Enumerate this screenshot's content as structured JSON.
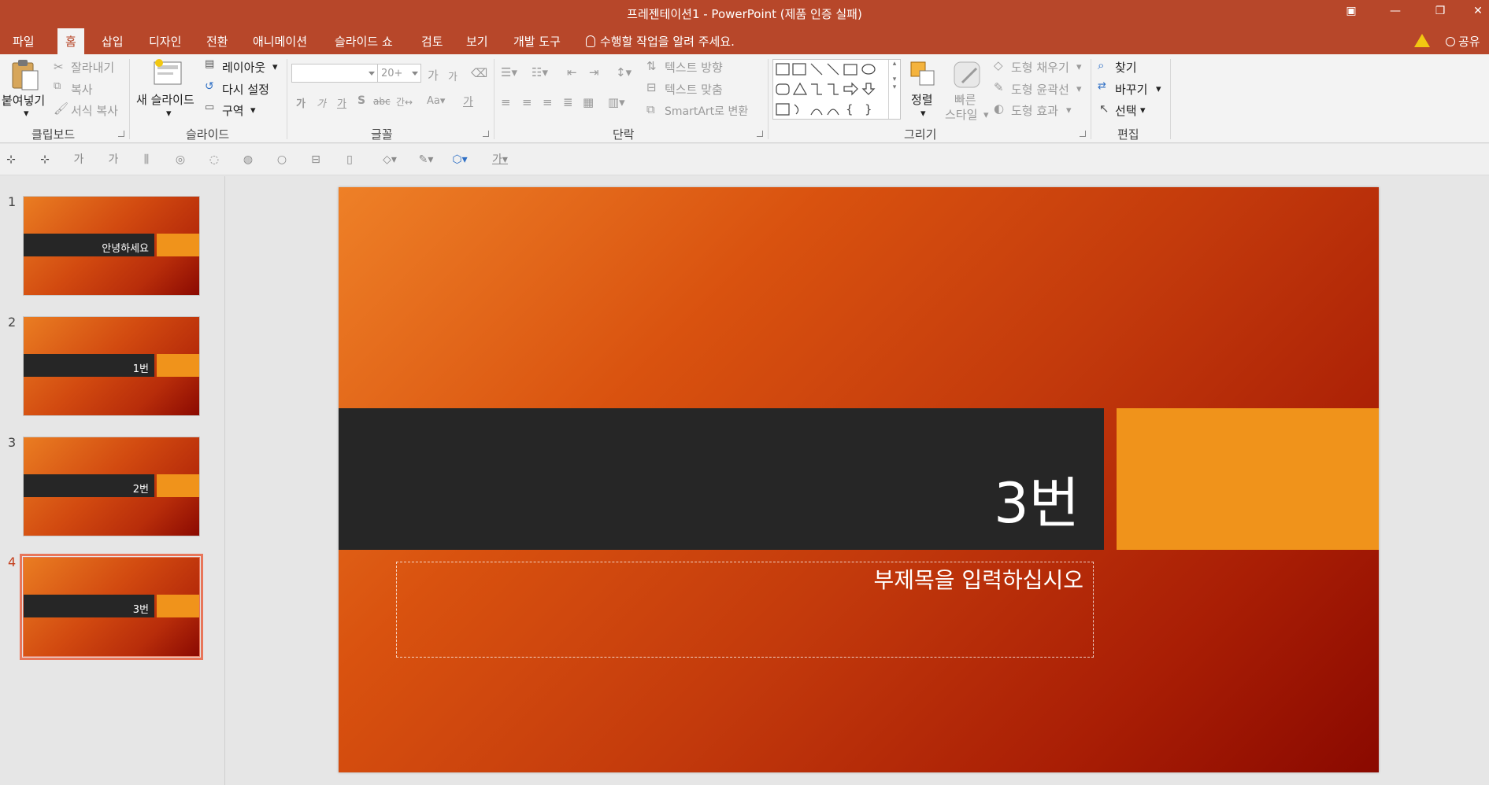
{
  "window": {
    "title": "프레젠테이션1 - PowerPoint (제품 인증 실패)",
    "controls": [
      "ribbon-display-icon",
      "minimize-icon",
      "restore-icon",
      "close-icon"
    ]
  },
  "tabs": [
    {
      "label": "파일",
      "active": false
    },
    {
      "label": "홈",
      "active": true
    },
    {
      "label": "삽입",
      "active": false
    },
    {
      "label": "디자인",
      "active": false
    },
    {
      "label": "전환",
      "active": false
    },
    {
      "label": "애니메이션",
      "active": false
    },
    {
      "label": "슬라이드 쇼",
      "active": false
    },
    {
      "label": "검토",
      "active": false
    },
    {
      "label": "보기",
      "active": false
    },
    {
      "label": "개발 도구",
      "active": false
    }
  ],
  "tellme": "수행할 작업을 알려 주세요.",
  "share": "공유",
  "ribbon": {
    "clipboard": {
      "label": "클립보드",
      "paste": "붙여넣기",
      "cut": "잘라내기",
      "copy": "복사",
      "format_painter": "서식 복사"
    },
    "slides": {
      "label": "슬라이드",
      "new_slide": "새 슬라이드",
      "layout": "레이아웃",
      "reset": "다시 설정",
      "section": "구역"
    },
    "font": {
      "label": "글꼴",
      "font_name": "",
      "font_size": "20+"
    },
    "paragraph": {
      "label": "단락",
      "text_direction": "텍스트 방향",
      "align_text": "텍스트 맞춤",
      "smartart": "SmartArt로 변환"
    },
    "drawing": {
      "label": "그리기",
      "arrange": "정렬",
      "quick_styles_1": "빠른",
      "quick_styles_2": "스타일",
      "shape_fill": "도형 채우기",
      "shape_outline": "도형 윤곽선",
      "shape_effects": "도형 효과"
    },
    "editing": {
      "label": "편집",
      "find": "찾기",
      "replace": "바꾸기",
      "select": "선택"
    }
  },
  "thumbnails": [
    {
      "num": "1",
      "label": "안녕하세요",
      "selected": false
    },
    {
      "num": "2",
      "label": "1번",
      "selected": false
    },
    {
      "num": "3",
      "label": "2번",
      "selected": false
    },
    {
      "num": "4",
      "label": "3번",
      "selected": true
    }
  ],
  "slide": {
    "title": "3번",
    "subtitle_placeholder": "부제목을 입력하십시오"
  },
  "colors": {
    "accent": "#b7472a",
    "slide_band": "#262626",
    "slide_accent": "#f0931b"
  }
}
